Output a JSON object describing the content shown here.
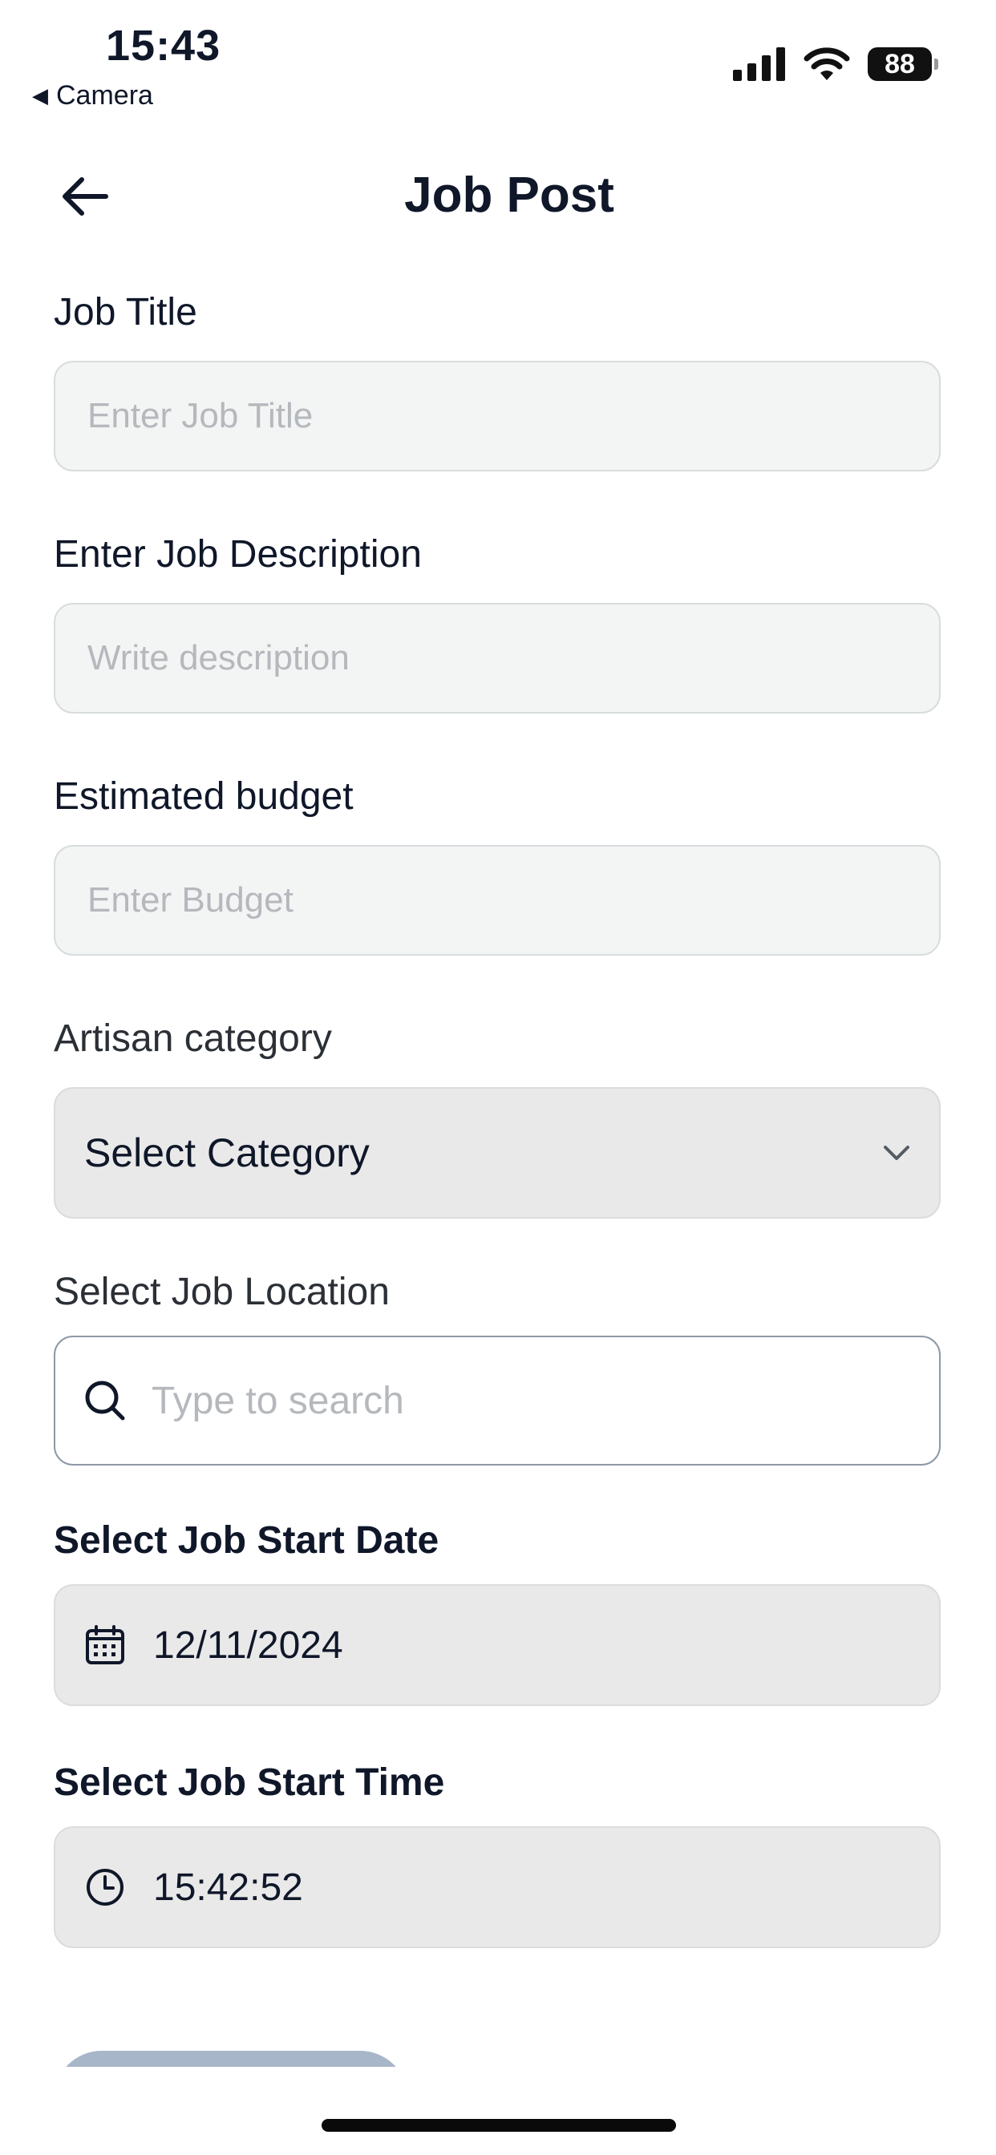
{
  "status_bar": {
    "time": "15:43",
    "back_app": "Camera",
    "battery": "88"
  },
  "header": {
    "title": "Job Post"
  },
  "form": {
    "job_title": {
      "label": "Job Title",
      "placeholder": "Enter Job Title"
    },
    "description": {
      "label": "Enter Job Description",
      "placeholder": "Write description"
    },
    "budget": {
      "label": "Estimated budget",
      "placeholder": "Enter Budget"
    },
    "category": {
      "label": "Artisan category",
      "value": "Select Category"
    },
    "location": {
      "label": "Select Job Location",
      "placeholder": "Type to search"
    },
    "start_date": {
      "label": "Select Job Start Date",
      "value": "12/11/2024"
    },
    "start_time": {
      "label": "Select Job Start Time",
      "value": "15:42:52"
    }
  },
  "icons": {
    "back": "arrow-left-icon",
    "dropdown": "chevron-down-icon",
    "search": "search-icon",
    "calendar": "calendar-icon",
    "clock": "clock-icon"
  },
  "colors": {
    "text_primary": "#0f1729",
    "placeholder": "#b5b8bc",
    "input_bg": "#f3f4f4",
    "select_bg": "#e9e9e9",
    "search_border": "#8e98a8",
    "button_disabled": "#a7b6c8"
  }
}
